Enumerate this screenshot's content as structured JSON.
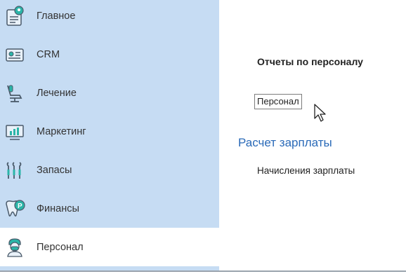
{
  "sidebar": {
    "items": [
      {
        "label": "Главное",
        "icon": "home-icon",
        "active": false
      },
      {
        "label": "CRM",
        "icon": "contact-card-icon",
        "active": false
      },
      {
        "label": "Лечение",
        "icon": "dental-chair-icon",
        "active": false
      },
      {
        "label": "Маркетинг",
        "icon": "presentation-icon",
        "active": false
      },
      {
        "label": "Запасы",
        "icon": "dental-tools-icon",
        "active": false
      },
      {
        "label": "Финансы",
        "icon": "tooth-coin-icon",
        "active": false
      },
      {
        "label": "Персонал",
        "icon": "doctor-icon",
        "active": true
      }
    ]
  },
  "content": {
    "heading": "Отчеты по персоналу",
    "report_link": "Персонал",
    "section_title": "Расчет зарплаты",
    "section_link": "Начисления зарплаты"
  },
  "colors": {
    "sidebar_bg": "#c6dcf3",
    "active_bg": "#ffffff",
    "accent": "#2a6ab8"
  }
}
